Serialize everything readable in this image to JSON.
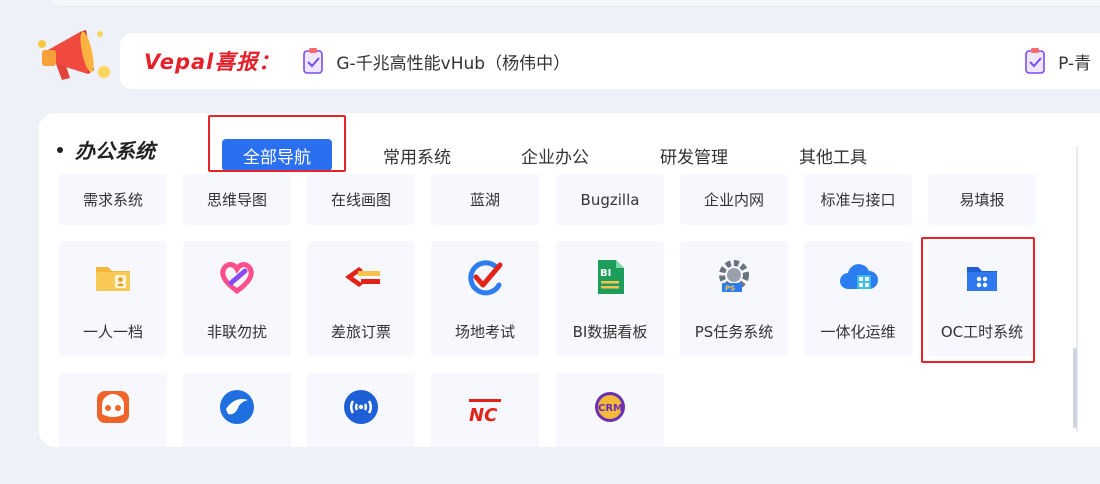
{
  "news": {
    "title": "Vepal喜报：",
    "items": [
      {
        "text": "G-千兆高性能vHub（杨伟中）"
      },
      {
        "text": "P-青"
      }
    ]
  },
  "office": {
    "title": "办公系统",
    "tabs": [
      "全部导航",
      "常用系统",
      "企业办公",
      "研发管理",
      "其他工具"
    ],
    "row1": [
      "需求系统",
      "思维导图",
      "在线画图",
      "蓝湖",
      "Bugzilla",
      "企业内网",
      "标准与接口",
      "易填报"
    ],
    "row2": [
      "一人一档",
      "非联勿扰",
      "差旅订票",
      "场地考试",
      "BI数据看板",
      "PS任务系统",
      "一体化运维",
      "OC工时系统"
    ],
    "icon_names": [
      "folder-user-icon",
      "heart-link-icon",
      "travel-ticket-icon",
      "exam-check-icon",
      "bi-board-icon",
      "ps-gear-icon",
      "cloud-ops-icon",
      "oc-folder-icon"
    ],
    "row3_icons": [
      "orange-face-icon",
      "eagle-icon",
      "wifi-signal-icon",
      "nc-logo-icon",
      "crm-logo-icon"
    ]
  },
  "colors": {
    "accent": "#2a6ff0",
    "highlight": "#e8232a",
    "news_title": "#e5202b"
  }
}
